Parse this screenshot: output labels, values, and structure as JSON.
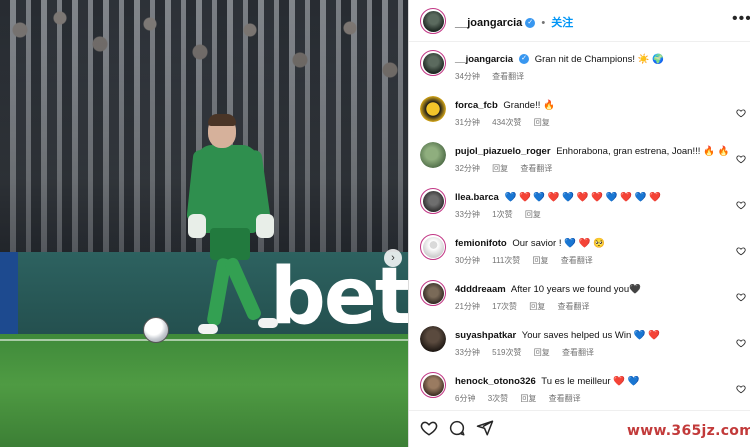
{
  "header": {
    "username": "__joangarcia",
    "follow_label": "关注",
    "more_label": "•••"
  },
  "ad_text": "bet",
  "caption": {
    "username": "__joangarcia",
    "text": "Gran nit de Champions! ☀️ 🌍",
    "time": "34分钟",
    "translate": "查看翻译"
  },
  "comments": [
    {
      "username": "forca_fcb",
      "text": "Grande!! 🔥",
      "time": "31分钟",
      "likes": "434次赞",
      "reply": "回复",
      "translate": ""
    },
    {
      "username": "pujol_piazuelo_roger",
      "text": "Enhorabona, gran estrena, Joan!!! 🔥 🔥",
      "time": "32分钟",
      "likes": "",
      "reply": "回复",
      "translate": "查看翻译"
    },
    {
      "username": "llea.barca",
      "text": "💙 ❤️ 💙 ❤️ 💙 ❤️ ❤️ 💙 ❤️ 💙 ❤️",
      "time": "33分钟",
      "likes": "1次赞",
      "reply": "回复",
      "translate": ""
    },
    {
      "username": "femionifoto",
      "text": "Our savior ! 💙 ❤️ 🥺",
      "time": "30分钟",
      "likes": "111次赞",
      "reply": "回复",
      "translate": "查看翻译"
    },
    {
      "username": "4dddreaam",
      "text": "After 10 years we found you🖤",
      "time": "21分钟",
      "likes": "17次赞",
      "reply": "回复",
      "translate": "查看翻译"
    },
    {
      "username": "suyashpatkar",
      "text": "Your saves helped us Win 💙 ❤️",
      "time": "33分钟",
      "likes": "519次赞",
      "reply": "回复",
      "translate": "查看翻译"
    },
    {
      "username": "henock_otono326",
      "text": "Tu es le meilleur ❤️ 💙",
      "time": "6分钟",
      "likes": "3次赞",
      "reply": "回复",
      "translate": "查看翻译"
    }
  ],
  "watermark": "www.365jz.com",
  "colors": {
    "accent": "#0095f6",
    "verified": "#3897f0",
    "heart_red": "#ed4956",
    "heart_blue": "#3a7bd5"
  },
  "icons": [
    "more-icon",
    "heart-icon",
    "comment-icon",
    "share-icon",
    "next-arrow-icon",
    "verified-icon"
  ]
}
